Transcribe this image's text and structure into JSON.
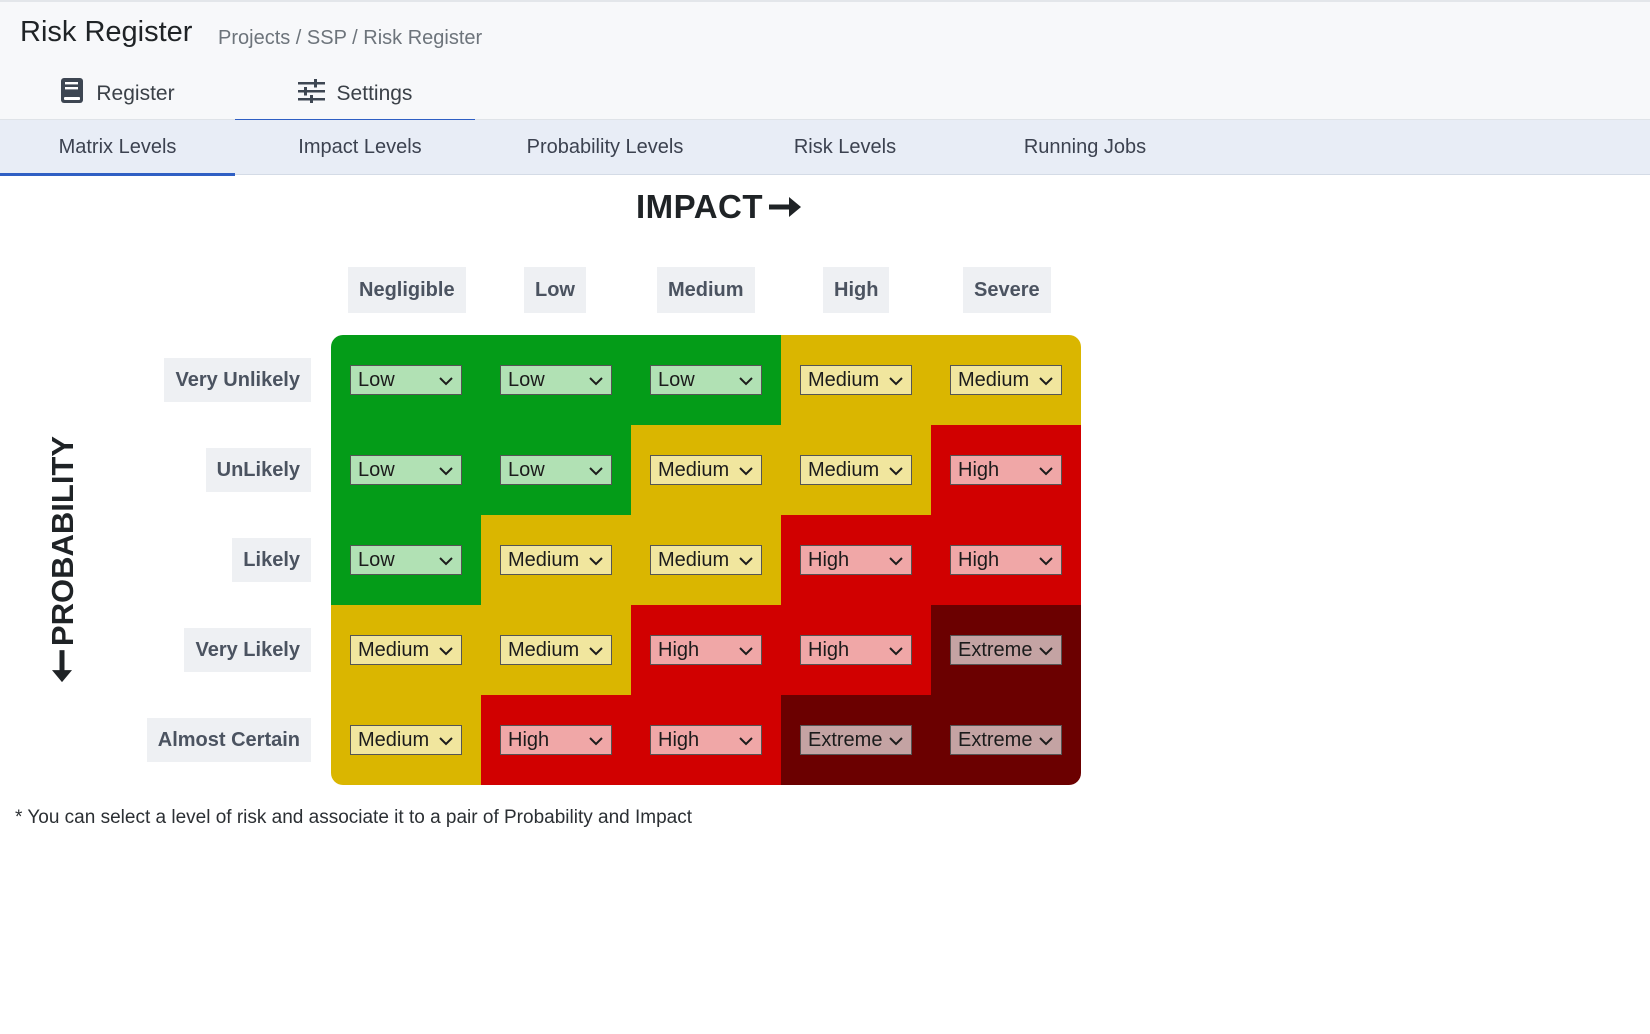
{
  "header": {
    "title": "Risk Register",
    "breadcrumb": "Projects / SSP / Risk Register"
  },
  "main_tabs": [
    {
      "label": "Register",
      "icon": "book-icon",
      "active": false
    },
    {
      "label": "Settings",
      "icon": "sliders-icon",
      "active": true
    }
  ],
  "sub_tabs": [
    {
      "label": "Matrix Levels",
      "active": true
    },
    {
      "label": "Impact Levels",
      "active": false
    },
    {
      "label": "Probability Levels",
      "active": false
    },
    {
      "label": "Risk Levels",
      "active": false
    },
    {
      "label": "Running Jobs",
      "active": false
    }
  ],
  "matrix": {
    "impact_title": "IMPACT",
    "probability_title": "PROBABILITY",
    "impact_levels": [
      "Negligible",
      "Low",
      "Medium",
      "High",
      "Severe"
    ],
    "probability_levels": [
      "Very Unlikely",
      "UnLikely",
      "Likely",
      "Very Likely",
      "Almost Certain"
    ],
    "cells": [
      [
        "Low",
        "Low",
        "Low",
        "Medium",
        "Medium"
      ],
      [
        "Low",
        "Low",
        "Medium",
        "Medium",
        "High"
      ],
      [
        "Low",
        "Medium",
        "Medium",
        "High",
        "High"
      ],
      [
        "Medium",
        "Medium",
        "High",
        "High",
        "Extreme"
      ],
      [
        "Medium",
        "High",
        "High",
        "Extreme",
        "Extreme"
      ]
    ],
    "risk_colors": {
      "Low": {
        "cell": "#049c18",
        "select": "#b1e1b4"
      },
      "Medium": {
        "cell": "#dab600",
        "select": "#f1e69e"
      },
      "High": {
        "cell": "#d10000",
        "select": "#f0a7a7"
      },
      "Extreme": {
        "cell": "#6b0000",
        "select": "#c4a3a3"
      }
    }
  },
  "footnote": "* You can select a level of risk and associate it to a pair of Probability and Impact"
}
